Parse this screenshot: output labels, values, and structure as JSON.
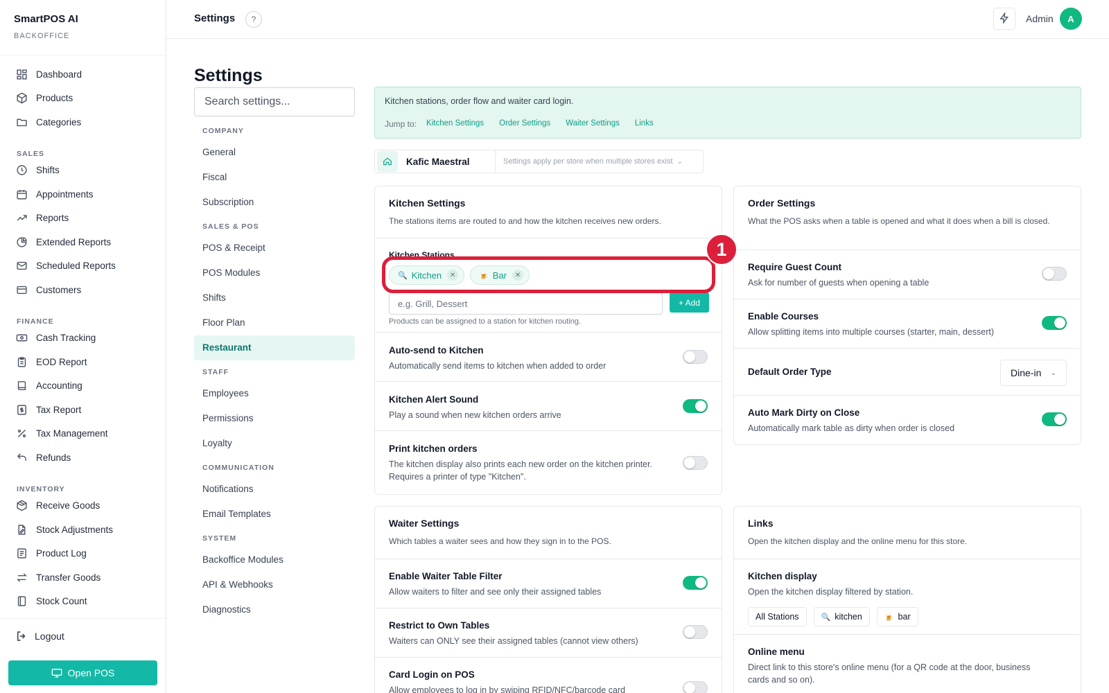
{
  "brand": {
    "name": "SmartPOS AI",
    "sub": "BACKOFFICE"
  },
  "sidebar": {
    "top": [
      {
        "label": "Dashboard",
        "icon": "dashboard-icon"
      },
      {
        "label": "Products",
        "icon": "box-icon"
      },
      {
        "label": "Categories",
        "icon": "folder-icon"
      }
    ],
    "sales_title": "SALES",
    "sales": [
      {
        "label": "Shifts",
        "icon": "clock-icon"
      },
      {
        "label": "Appointments",
        "icon": "calendar-icon"
      },
      {
        "label": "Reports",
        "icon": "trend-icon"
      },
      {
        "label": "Extended Reports",
        "icon": "pie-icon"
      },
      {
        "label": "Scheduled Reports",
        "icon": "mail-icon"
      },
      {
        "label": "Customers",
        "icon": "card-icon"
      }
    ],
    "finance_title": "FINANCE",
    "finance": [
      {
        "label": "Cash Tracking",
        "icon": "cash-icon"
      },
      {
        "label": "EOD Report",
        "icon": "clipboard-icon"
      },
      {
        "label": "Accounting",
        "icon": "book-icon"
      },
      {
        "label": "Tax Report",
        "icon": "dollar-doc-icon"
      },
      {
        "label": "Tax Management",
        "icon": "percent-icon"
      },
      {
        "label": "Refunds",
        "icon": "undo-icon"
      }
    ],
    "inventory_title": "INVENTORY",
    "inventory": [
      {
        "label": "Receive Goods",
        "icon": "package-icon"
      },
      {
        "label": "Stock Adjustments",
        "icon": "doc-edit-icon"
      },
      {
        "label": "Product Log",
        "icon": "log-icon"
      },
      {
        "label": "Transfer Goods",
        "icon": "transfer-icon"
      },
      {
        "label": "Stock Count",
        "icon": "notebook-icon"
      }
    ],
    "logout": "Logout",
    "open_pos": "Open POS"
  },
  "header": {
    "title": "Settings",
    "help": "?",
    "admin": "Admin",
    "avatar": "A"
  },
  "page": {
    "title": "Settings",
    "search_placeholder": "Search settings..."
  },
  "settings_nav": {
    "company_title": "COMPANY",
    "company": [
      "General",
      "Fiscal",
      "Subscription"
    ],
    "salespos_title": "SALES & POS",
    "salespos": [
      "POS & Receipt",
      "POS Modules",
      "Shifts",
      "Floor Plan",
      "Restaurant"
    ],
    "staff_title": "STAFF",
    "staff": [
      "Employees",
      "Permissions",
      "Loyalty"
    ],
    "comm_title": "COMMUNICATION",
    "comm": [
      "Notifications",
      "Email Templates"
    ],
    "system_title": "SYSTEM",
    "system": [
      "Backoffice Modules",
      "API & Webhooks",
      "Diagnostics"
    ]
  },
  "banner": {
    "text": "Kitchen stations, order flow and waiter card login.",
    "jump_label": "Jump to:",
    "links": [
      "Kitchen Settings",
      "Order Settings",
      "Waiter Settings",
      "Links"
    ]
  },
  "store": {
    "name": "Kafic Maestral",
    "note": "Settings apply per store when multiple stores exist"
  },
  "kitchen": {
    "title": "Kitchen Settings",
    "desc": "The stations items are routed to and how the kitchen receives new orders.",
    "stations_label": "Kitchen Stations",
    "chips": [
      {
        "label": "Kitchen",
        "icon": "🔍"
      },
      {
        "label": "Bar",
        "icon": "🍺"
      }
    ],
    "input_placeholder": "e.g. Grill, Dessert",
    "add": "+ Add",
    "help": "Products can be assigned to a station for kitchen routing.",
    "rows": [
      {
        "title": "Auto-send to Kitchen",
        "desc": "Automatically send items to kitchen when added to order",
        "on": false
      },
      {
        "title": "Kitchen Alert Sound",
        "desc": "Play a sound when new kitchen orders arrive",
        "on": true
      },
      {
        "title": "Print kitchen orders",
        "desc": "The kitchen display also prints each new order on the kitchen printer. Requires a printer of type \"Kitchen\".",
        "on": false
      }
    ]
  },
  "order": {
    "title": "Order Settings",
    "desc": "What the POS asks when a table is opened and what it does when a bill is closed.",
    "rows": [
      {
        "title": "Require Guest Count",
        "desc": "Ask for number of guests when opening a table",
        "on": false
      },
      {
        "title": "Enable Courses",
        "desc": "Allow splitting items into multiple courses (starter, main, dessert)",
        "on": true
      }
    ],
    "default_type_label": "Default Order Type",
    "default_type_value": "Dine-in",
    "dirty": {
      "title": "Auto Mark Dirty on Close",
      "desc": "Automatically mark table as dirty when order is closed",
      "on": true
    }
  },
  "waiter": {
    "title": "Waiter Settings",
    "desc": "Which tables a waiter sees and how they sign in to the POS.",
    "rows": [
      {
        "title": "Enable Waiter Table Filter",
        "desc": "Allow waiters to filter and see only their assigned tables",
        "on": true
      },
      {
        "title": "Restrict to Own Tables",
        "desc": "Waiters can ONLY see their assigned tables (cannot view others)",
        "on": false
      },
      {
        "title": "Card Login on POS",
        "desc": "Allow employees to log in by swiping RFID/NFC/barcode card",
        "on": false
      }
    ]
  },
  "links": {
    "title": "Links",
    "desc": "Open the kitchen display and the online menu for this store.",
    "kd_title": "Kitchen display",
    "kd_desc": "Open the kitchen display filtered by station.",
    "kd_buttons": [
      {
        "label": "All Stations",
        "icon": ""
      },
      {
        "label": "kitchen",
        "icon": "🔍"
      },
      {
        "label": "bar",
        "icon": "🍺"
      }
    ],
    "om_title": "Online menu",
    "om_desc": "Direct link to this store's online menu (for a QR code at the door, business cards and so on)."
  },
  "annotation": {
    "marker": "1"
  }
}
